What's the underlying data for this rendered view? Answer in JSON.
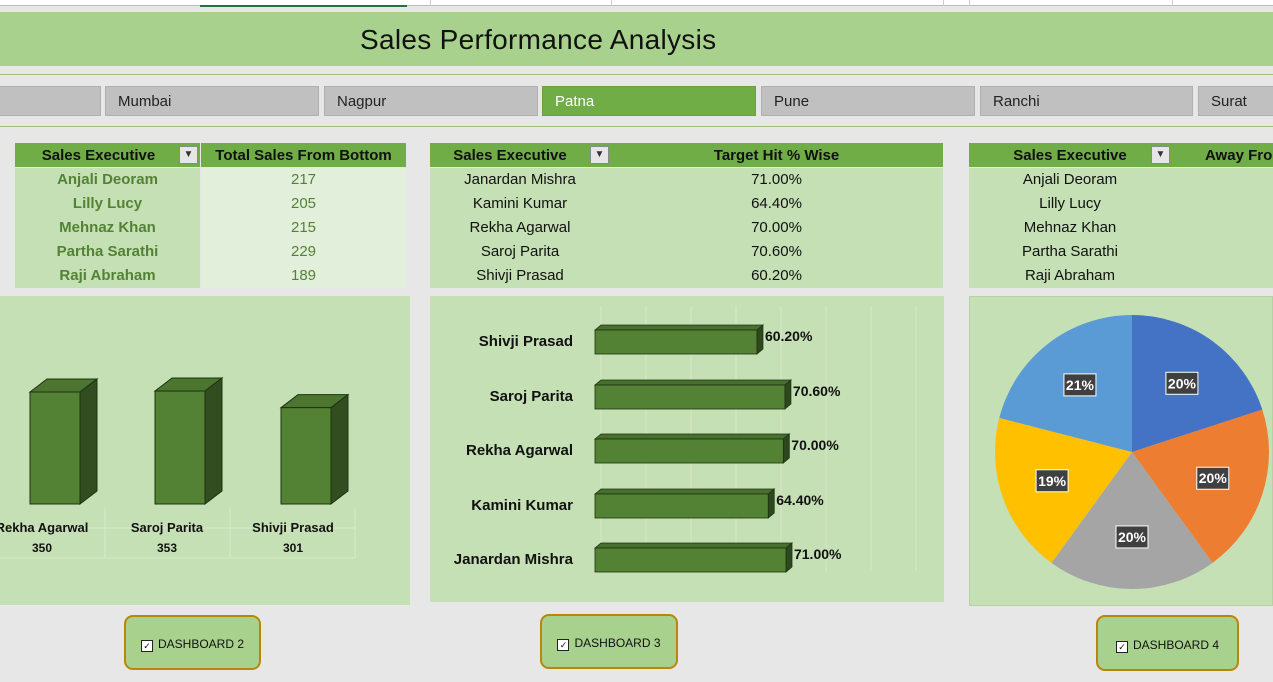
{
  "title": "Sales Performance Analysis",
  "slicers": [
    {
      "label": "",
      "active": false
    },
    {
      "label": "Mumbai",
      "active": false
    },
    {
      "label": "Nagpur",
      "active": false
    },
    {
      "label": "Patna",
      "active": true
    },
    {
      "label": "Pune",
      "active": false
    },
    {
      "label": "Ranchi",
      "active": false
    },
    {
      "label": "Surat",
      "active": false
    }
  ],
  "table1": {
    "headers": [
      "Sales Executive",
      "Total Sales From Bottom"
    ],
    "rows": [
      [
        "Anjali Deoram",
        "217"
      ],
      [
        "Lilly Lucy",
        "205"
      ],
      [
        "Mehnaz Khan",
        "215"
      ],
      [
        "Partha Sarathi",
        "229"
      ],
      [
        "Raji Abraham",
        "189"
      ]
    ]
  },
  "table2": {
    "headers": [
      "Sales Executive",
      "Target Hit % Wise"
    ],
    "rows": [
      [
        "Janardan Mishra",
        "71.00%"
      ],
      [
        "Kamini Kumar",
        "64.40%"
      ],
      [
        "Rekha Agarwal",
        "70.00%"
      ],
      [
        "Saroj Parita",
        "70.60%"
      ],
      [
        "Shivji Prasad",
        "60.20%"
      ]
    ]
  },
  "table3": {
    "headers": [
      "Sales Executive",
      "Away Fro"
    ],
    "rows": [
      [
        "Anjali Deoram"
      ],
      [
        "Lilly Lucy"
      ],
      [
        "Mehnaz Khan"
      ],
      [
        "Partha Sarathi"
      ],
      [
        "Raji Abraham"
      ]
    ]
  },
  "chart_data": [
    {
      "type": "bar",
      "categories": [
        "Rekha Agarwal",
        "Saroj Parita",
        "Shivji Prasad"
      ],
      "values": [
        350,
        353,
        301
      ],
      "value_labels": [
        "350",
        "353",
        "301"
      ],
      "color": "#548235"
    },
    {
      "type": "bar",
      "orientation": "horizontal",
      "categories": [
        "Shivji Prasad",
        "Saroj Parita",
        "Rekha Agarwal",
        "Kamini Kumar",
        "Janardan Mishra"
      ],
      "values": [
        60.2,
        70.6,
        70.0,
        64.4,
        71.0
      ],
      "value_labels": [
        "60.20%",
        "70.60%",
        "70.00%",
        "64.40%",
        "71.00%"
      ],
      "color": "#548235"
    },
    {
      "type": "pie",
      "values": [
        20,
        20,
        20,
        19,
        21
      ],
      "value_labels": [
        "20%",
        "20%",
        "20%",
        "19%",
        "21%"
      ],
      "colors": [
        "#4472c4",
        "#ed7d31",
        "#a5a5a5",
        "#ffc000",
        "#5b9bd5"
      ]
    }
  ],
  "buttons": [
    {
      "label": "DASHBOARD 2"
    },
    {
      "label": "DASHBOARD 3"
    },
    {
      "label": "DASHBOARD 4"
    }
  ],
  "icons": {
    "filter": "filter-icon",
    "checkbox": "checkbox-icon"
  }
}
